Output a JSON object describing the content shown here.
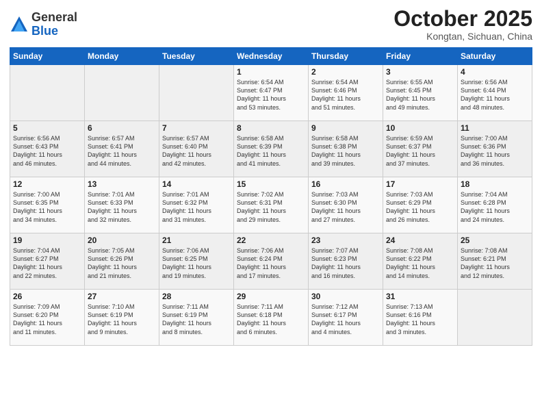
{
  "header": {
    "logo_general": "General",
    "logo_blue": "Blue",
    "month_title": "October 2025",
    "location": "Kongtan, Sichuan, China"
  },
  "weekdays": [
    "Sunday",
    "Monday",
    "Tuesday",
    "Wednesday",
    "Thursday",
    "Friday",
    "Saturday"
  ],
  "weeks": [
    [
      {
        "day": "",
        "info": ""
      },
      {
        "day": "",
        "info": ""
      },
      {
        "day": "",
        "info": ""
      },
      {
        "day": "1",
        "info": "Sunrise: 6:54 AM\nSunset: 6:47 PM\nDaylight: 11 hours\nand 53 minutes."
      },
      {
        "day": "2",
        "info": "Sunrise: 6:54 AM\nSunset: 6:46 PM\nDaylight: 11 hours\nand 51 minutes."
      },
      {
        "day": "3",
        "info": "Sunrise: 6:55 AM\nSunset: 6:45 PM\nDaylight: 11 hours\nand 49 minutes."
      },
      {
        "day": "4",
        "info": "Sunrise: 6:56 AM\nSunset: 6:44 PM\nDaylight: 11 hours\nand 48 minutes."
      }
    ],
    [
      {
        "day": "5",
        "info": "Sunrise: 6:56 AM\nSunset: 6:43 PM\nDaylight: 11 hours\nand 46 minutes."
      },
      {
        "day": "6",
        "info": "Sunrise: 6:57 AM\nSunset: 6:41 PM\nDaylight: 11 hours\nand 44 minutes."
      },
      {
        "day": "7",
        "info": "Sunrise: 6:57 AM\nSunset: 6:40 PM\nDaylight: 11 hours\nand 42 minutes."
      },
      {
        "day": "8",
        "info": "Sunrise: 6:58 AM\nSunset: 6:39 PM\nDaylight: 11 hours\nand 41 minutes."
      },
      {
        "day": "9",
        "info": "Sunrise: 6:58 AM\nSunset: 6:38 PM\nDaylight: 11 hours\nand 39 minutes."
      },
      {
        "day": "10",
        "info": "Sunrise: 6:59 AM\nSunset: 6:37 PM\nDaylight: 11 hours\nand 37 minutes."
      },
      {
        "day": "11",
        "info": "Sunrise: 7:00 AM\nSunset: 6:36 PM\nDaylight: 11 hours\nand 36 minutes."
      }
    ],
    [
      {
        "day": "12",
        "info": "Sunrise: 7:00 AM\nSunset: 6:35 PM\nDaylight: 11 hours\nand 34 minutes."
      },
      {
        "day": "13",
        "info": "Sunrise: 7:01 AM\nSunset: 6:33 PM\nDaylight: 11 hours\nand 32 minutes."
      },
      {
        "day": "14",
        "info": "Sunrise: 7:01 AM\nSunset: 6:32 PM\nDaylight: 11 hours\nand 31 minutes."
      },
      {
        "day": "15",
        "info": "Sunrise: 7:02 AM\nSunset: 6:31 PM\nDaylight: 11 hours\nand 29 minutes."
      },
      {
        "day": "16",
        "info": "Sunrise: 7:03 AM\nSunset: 6:30 PM\nDaylight: 11 hours\nand 27 minutes."
      },
      {
        "day": "17",
        "info": "Sunrise: 7:03 AM\nSunset: 6:29 PM\nDaylight: 11 hours\nand 26 minutes."
      },
      {
        "day": "18",
        "info": "Sunrise: 7:04 AM\nSunset: 6:28 PM\nDaylight: 11 hours\nand 24 minutes."
      }
    ],
    [
      {
        "day": "19",
        "info": "Sunrise: 7:04 AM\nSunset: 6:27 PM\nDaylight: 11 hours\nand 22 minutes."
      },
      {
        "day": "20",
        "info": "Sunrise: 7:05 AM\nSunset: 6:26 PM\nDaylight: 11 hours\nand 21 minutes."
      },
      {
        "day": "21",
        "info": "Sunrise: 7:06 AM\nSunset: 6:25 PM\nDaylight: 11 hours\nand 19 minutes."
      },
      {
        "day": "22",
        "info": "Sunrise: 7:06 AM\nSunset: 6:24 PM\nDaylight: 11 hours\nand 17 minutes."
      },
      {
        "day": "23",
        "info": "Sunrise: 7:07 AM\nSunset: 6:23 PM\nDaylight: 11 hours\nand 16 minutes."
      },
      {
        "day": "24",
        "info": "Sunrise: 7:08 AM\nSunset: 6:22 PM\nDaylight: 11 hours\nand 14 minutes."
      },
      {
        "day": "25",
        "info": "Sunrise: 7:08 AM\nSunset: 6:21 PM\nDaylight: 11 hours\nand 12 minutes."
      }
    ],
    [
      {
        "day": "26",
        "info": "Sunrise: 7:09 AM\nSunset: 6:20 PM\nDaylight: 11 hours\nand 11 minutes."
      },
      {
        "day": "27",
        "info": "Sunrise: 7:10 AM\nSunset: 6:19 PM\nDaylight: 11 hours\nand 9 minutes."
      },
      {
        "day": "28",
        "info": "Sunrise: 7:11 AM\nSunset: 6:19 PM\nDaylight: 11 hours\nand 8 minutes."
      },
      {
        "day": "29",
        "info": "Sunrise: 7:11 AM\nSunset: 6:18 PM\nDaylight: 11 hours\nand 6 minutes."
      },
      {
        "day": "30",
        "info": "Sunrise: 7:12 AM\nSunset: 6:17 PM\nDaylight: 11 hours\nand 4 minutes."
      },
      {
        "day": "31",
        "info": "Sunrise: 7:13 AM\nSunset: 6:16 PM\nDaylight: 11 hours\nand 3 minutes."
      },
      {
        "day": "",
        "info": ""
      }
    ]
  ]
}
